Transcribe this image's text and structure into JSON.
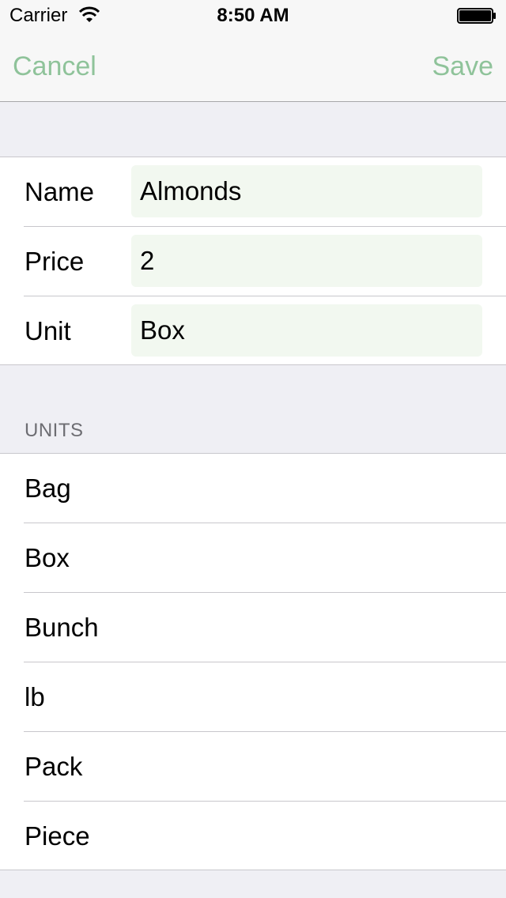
{
  "status_bar": {
    "carrier": "Carrier",
    "time": "8:50 AM"
  },
  "nav": {
    "cancel_label": "Cancel",
    "save_label": "Save",
    "accent_color": "#8fc39a"
  },
  "form": {
    "rows": [
      {
        "label": "Name",
        "value": "Almonds"
      },
      {
        "label": "Price",
        "value": "2"
      },
      {
        "label": "Unit",
        "value": "Box"
      }
    ]
  },
  "units": {
    "header": "UNITS",
    "items": [
      {
        "label": "Bag"
      },
      {
        "label": "Box"
      },
      {
        "label": "Bunch"
      },
      {
        "label": "lb"
      },
      {
        "label": "Pack"
      },
      {
        "label": "Piece"
      }
    ]
  }
}
